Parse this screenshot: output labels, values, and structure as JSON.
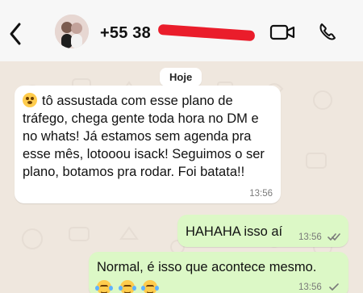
{
  "header": {
    "contact_phone": "+55 38",
    "video_icon": "video-icon",
    "call_icon": "phone-icon"
  },
  "chat": {
    "date_label": "Hoje",
    "messages": [
      {
        "direction": "incoming",
        "emoji": "😳",
        "text": "tô assustada com esse plano de tráfego, chega gente toda hora no DM e no whats! Já estamos sem agenda pra esse mês, lotooou isack! Seguimos o ser plano, botamos pra rodar. Foi batata!!",
        "time": "13:56"
      },
      {
        "direction": "outgoing",
        "text": "HAHAHA isso aí",
        "time": "13:56",
        "status_icon": "double-check-icon"
      },
      {
        "direction": "outgoing",
        "text": "Normal, é isso que acontece mesmo.",
        "emojis": [
          "😂",
          "😂",
          "😂"
        ],
        "time": "13:56",
        "status_icon": "check-icon"
      }
    ]
  },
  "colors": {
    "incoming_bubble": "#ffffff",
    "outgoing_bubble": "#dcf8c6",
    "chat_background": "#efe7de",
    "redaction": "#ea1d2b"
  }
}
